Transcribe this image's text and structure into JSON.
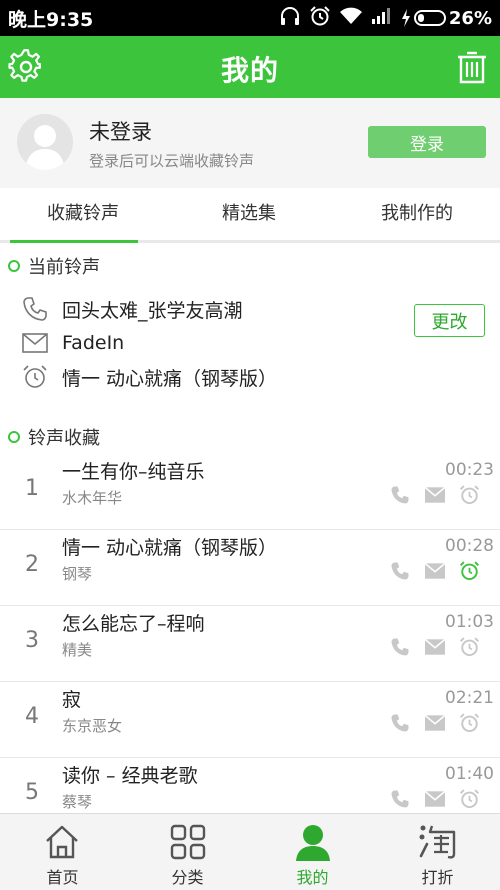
{
  "status_bar": {
    "time": "晚上9:35",
    "battery_percent": "26%",
    "battery_level": 0.26
  },
  "header": {
    "title": "我的",
    "left_icon": "settings-gear-icon",
    "right_icon": "trash-icon",
    "accent": "#3cc43c"
  },
  "profile": {
    "name": "未登录",
    "subtitle": "登录后可以云端收藏铃声",
    "login_label": "登录"
  },
  "tabs": [
    {
      "label": "收藏铃声",
      "active": true
    },
    {
      "label": "精选集",
      "active": false
    },
    {
      "label": "我制作的",
      "active": false
    }
  ],
  "current": {
    "heading": "当前铃声",
    "change_label": "更改",
    "items": [
      {
        "icon": "phone-icon",
        "text": "回头太难_张学友高潮"
      },
      {
        "icon": "mail-icon",
        "text": "FadeIn"
      },
      {
        "icon": "alarm-clock-icon",
        "text": "情一 动心就痛（钢琴版）"
      }
    ]
  },
  "favorites": {
    "heading": "铃声收藏",
    "items": [
      {
        "index": "1",
        "title": "一生有你–纯音乐",
        "artist": "水木年华",
        "duration": "00:23",
        "alarm_active": false
      },
      {
        "index": "2",
        "title": "情一 动心就痛（钢琴版）",
        "artist": "钢琴",
        "duration": "00:28",
        "alarm_active": true
      },
      {
        "index": "3",
        "title": "怎么能忘了–程响",
        "artist": "精美",
        "duration": "01:03",
        "alarm_active": false
      },
      {
        "index": "4",
        "title": "寂",
        "artist": "东京恶女",
        "duration": "02:21",
        "alarm_active": false
      },
      {
        "index": "5",
        "title": "读你 – 经典老歌",
        "artist": "蔡琴",
        "duration": "01:40",
        "alarm_active": false
      }
    ]
  },
  "bottom_nav": [
    {
      "label": "首页",
      "icon": "home-icon",
      "active": false
    },
    {
      "label": "分类",
      "icon": "category-grid-icon",
      "active": false
    },
    {
      "label": "我的",
      "icon": "user-icon",
      "active": true
    },
    {
      "label": "打折",
      "icon": "taobao-icon",
      "active": false
    }
  ]
}
